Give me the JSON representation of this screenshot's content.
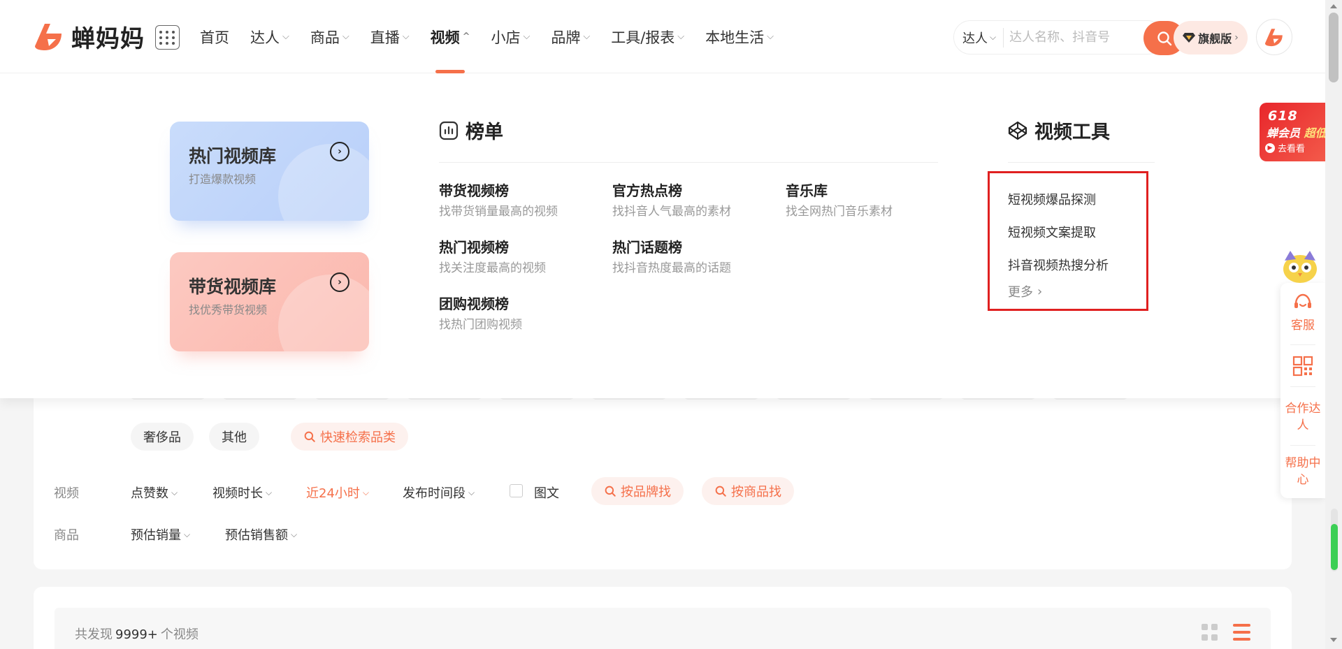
{
  "header": {
    "logo_text": "蝉妈妈",
    "nav": [
      {
        "label": "首页",
        "has_dropdown": false
      },
      {
        "label": "达人",
        "has_dropdown": true
      },
      {
        "label": "商品",
        "has_dropdown": true
      },
      {
        "label": "直播",
        "has_dropdown": true
      },
      {
        "label": "视频",
        "has_dropdown": true,
        "active": true
      },
      {
        "label": "小店",
        "has_dropdown": true
      },
      {
        "label": "品牌",
        "has_dropdown": true
      },
      {
        "label": "工具/报表",
        "has_dropdown": true
      },
      {
        "label": "本地生活",
        "has_dropdown": true
      }
    ],
    "search": {
      "type": "达人",
      "placeholder": "达人名称、抖音号"
    },
    "vip_label": "旗舰版"
  },
  "mega": {
    "libraries": [
      {
        "title": "热门视频库",
        "subtitle": "打造爆款视频",
        "color": "#c9dcfb"
      },
      {
        "title": "带货视频库",
        "subtitle": "找优秀带货视频",
        "color": "#fcc9c1"
      }
    ],
    "rank_title": "榜单",
    "ranks": [
      {
        "title": "带货视频榜",
        "subtitle": "找带货销量最高的视频"
      },
      {
        "title": "官方热点榜",
        "subtitle": "找抖音人气最高的素材"
      },
      {
        "title": "音乐库",
        "subtitle": "找全网热门音乐素材"
      },
      {
        "title": "热门视频榜",
        "subtitle": "找关注度最高的视频"
      },
      {
        "title": "热门话题榜",
        "subtitle": "找抖音热度最高的话题"
      },
      {
        "title": "团购视频榜",
        "subtitle": "找热门团购视频"
      }
    ],
    "tools_title": "视频工具",
    "tools": [
      "短视频爆品探测",
      "短视频文案提取",
      "抖音视频热搜分析"
    ],
    "tools_more": "更多"
  },
  "filters": {
    "category_tags": [
      "奢侈品",
      "其他"
    ],
    "quick_search": "快速检索品类",
    "video_label": "视频",
    "video_filters": [
      "点赞数",
      "视频时长",
      "近24小时",
      "发布时间段"
    ],
    "image_text_label": "图文",
    "by_brand": "按品牌找",
    "by_product": "按商品找",
    "product_label": "商品",
    "product_filters": [
      "预估销量",
      "预估销售额"
    ]
  },
  "results": {
    "prefix": "共发现",
    "count": "9999+",
    "suffix": "个视频"
  },
  "promo": {
    "line1": "618",
    "line2": "蝉会员",
    "line2_highlight": "超低",
    "line3": "去看看"
  },
  "sidebar": {
    "service": "客服",
    "cooperate": "合作达人",
    "help": "帮助中心"
  },
  "colors": {
    "accent": "#f5704a",
    "highlight_box": "#e02020"
  }
}
